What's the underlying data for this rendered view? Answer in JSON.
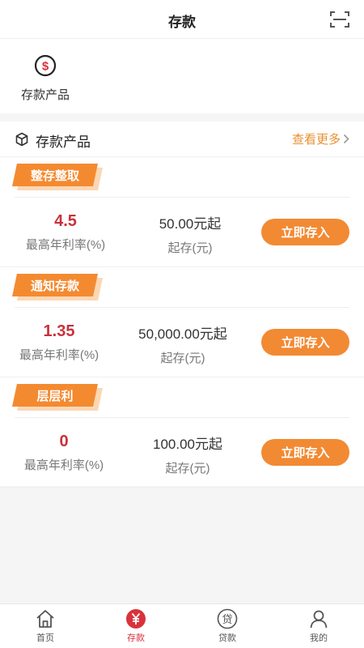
{
  "header": {
    "title": "存款",
    "scan_icon": "scan-icon"
  },
  "quick": {
    "items": [
      {
        "label": "存款产品",
        "icon": "dollar-circle-icon"
      }
    ]
  },
  "section": {
    "title": "存款产品",
    "more": "查看更多",
    "icon": "cube-icon"
  },
  "products": [
    {
      "tag": "整存整取",
      "rate": "4.5",
      "rate_label": "最高年利率(%)",
      "amount": "50.00元起",
      "amount_label": "起存(元)",
      "button": "立即存入"
    },
    {
      "tag": "通知存款",
      "rate": "1.35",
      "rate_label": "最高年利率(%)",
      "amount": "50,000.00元起",
      "amount_label": "起存(元)",
      "button": "立即存入"
    },
    {
      "tag": "层层利",
      "rate": "0",
      "rate_label": "最高年利率(%)",
      "amount": "100.00元起",
      "amount_label": "起存(元)",
      "button": "立即存入"
    }
  ],
  "tabbar": {
    "items": [
      {
        "label": "首页",
        "icon": "home-icon"
      },
      {
        "label": "存款",
        "icon": "yuan-circle-icon",
        "active": true
      },
      {
        "label": "贷款",
        "icon": "loan-icon"
      },
      {
        "label": "我的",
        "icon": "user-icon"
      }
    ]
  },
  "colors": {
    "accent": "#f28a33",
    "rate": "#c8323b",
    "active_tab": "#d9323c",
    "more": "#e8902f"
  }
}
